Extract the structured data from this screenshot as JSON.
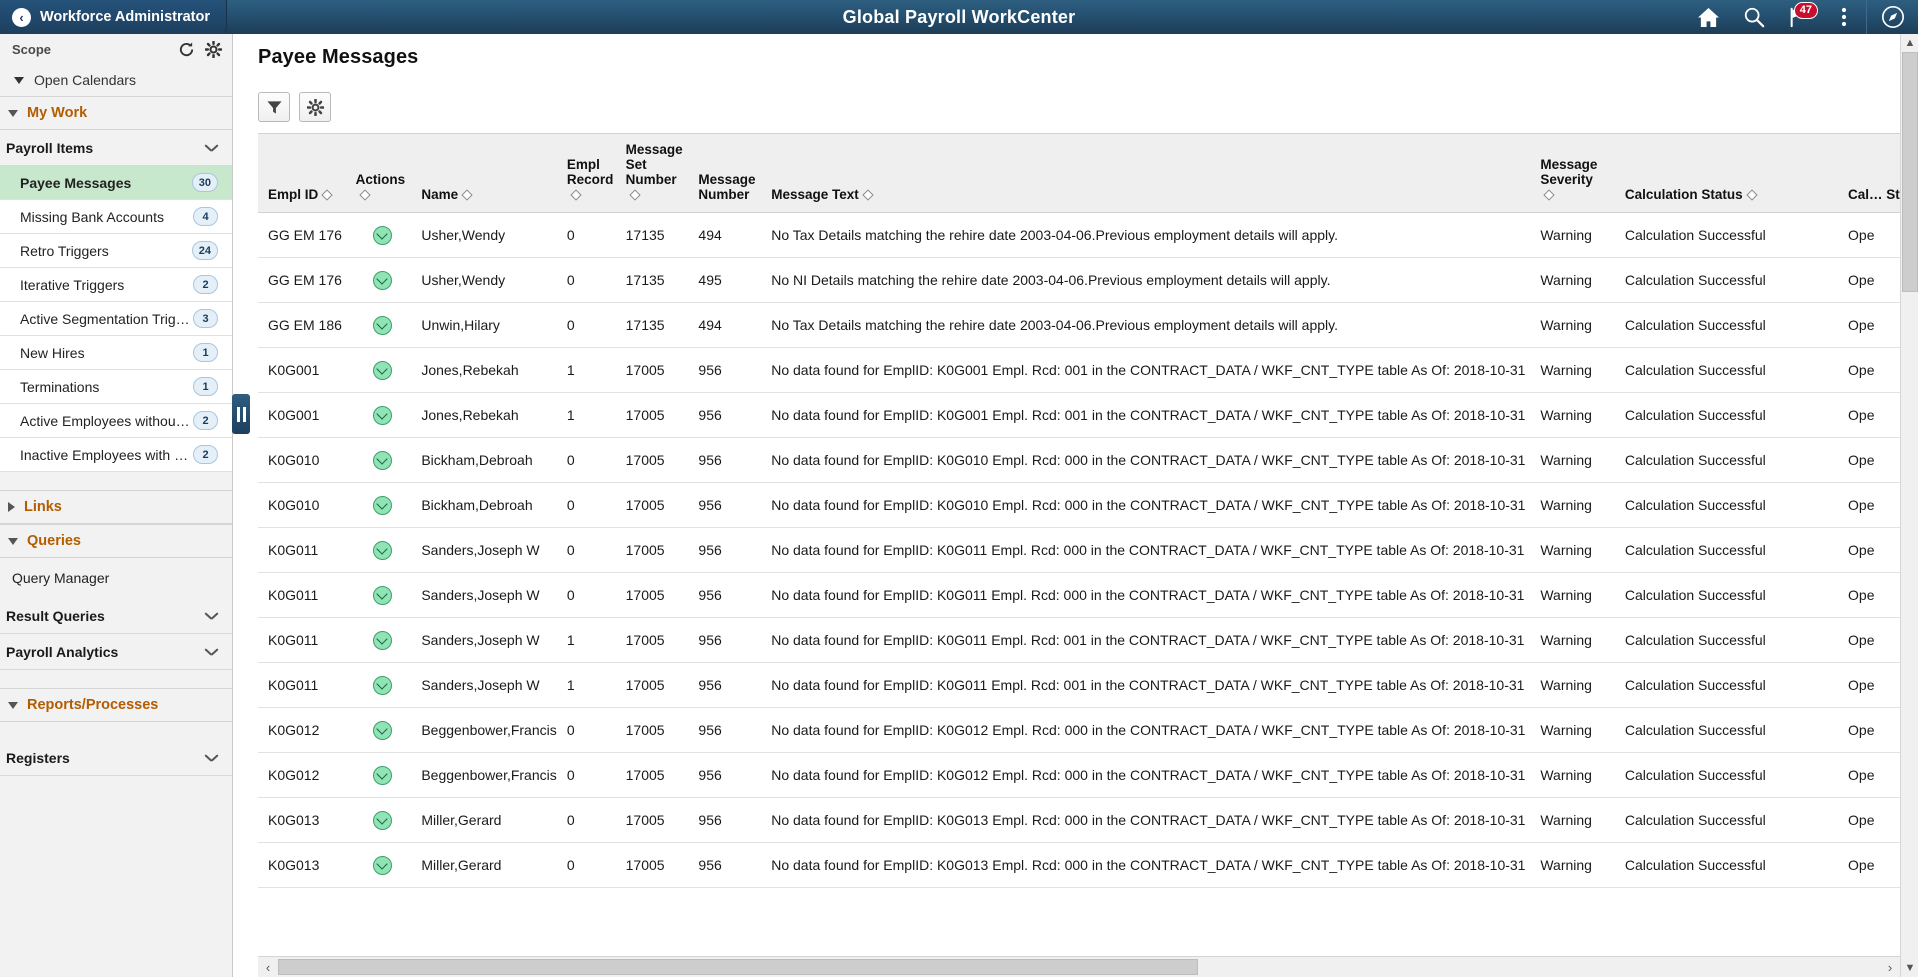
{
  "header": {
    "back_label": "Workforce Administrator",
    "title": "Global Payroll WorkCenter",
    "icons": {
      "home": "home-icon",
      "search": "search-icon",
      "notifications": "notification-flag-icon",
      "notification_count": "47",
      "actions": "kebab-menu-icon",
      "navbar": "navbar-compass-icon"
    }
  },
  "sidebar": {
    "scope_label": "Scope",
    "refresh_icon": "refresh-icon",
    "settings_icon": "gear-icon",
    "open_calendars": "Open Calendars",
    "sections": {
      "my_work": "My Work",
      "links": "Links",
      "queries": "Queries",
      "reports_processes": "Reports/Processes"
    },
    "groups": {
      "payroll_items": "Payroll Items",
      "result_queries": "Result Queries",
      "payroll_analytics": "Payroll Analytics",
      "registers": "Registers"
    },
    "query_manager": "Query Manager",
    "items": [
      {
        "label": "Payee Messages",
        "count": "30",
        "selected": true
      },
      {
        "label": "Missing Bank Accounts",
        "count": "4",
        "selected": false
      },
      {
        "label": "Retro Triggers",
        "count": "24",
        "selected": false
      },
      {
        "label": "Iterative Triggers",
        "count": "2",
        "selected": false
      },
      {
        "label": "Active Segmentation Triggers",
        "count": "3",
        "selected": false
      },
      {
        "label": "New Hires",
        "count": "1",
        "selected": false
      },
      {
        "label": "Terminations",
        "count": "1",
        "selected": false
      },
      {
        "label": "Active Employees without G…",
        "count": "2",
        "selected": false
      },
      {
        "label": "Inactive Employees with Gr…",
        "count": "2",
        "selected": false
      }
    ]
  },
  "main": {
    "page_title": "Payee Messages",
    "toolbar": {
      "filter_icon": "filter-funnel-icon",
      "settings_icon": "gear-icon"
    },
    "columns": [
      {
        "label": "Empl ID",
        "sortable": true
      },
      {
        "label": "Actions",
        "sortable": true
      },
      {
        "label": "Name",
        "sortable": true
      },
      {
        "label": "Empl Record",
        "sortable": true
      },
      {
        "label": "Message Set Number",
        "sortable": true
      },
      {
        "label": "Message Number",
        "sortable": false
      },
      {
        "label": "Message Text",
        "sortable": true
      },
      {
        "label": "Message Severity",
        "sortable": true
      },
      {
        "label": "Calculation Status",
        "sortable": true
      },
      {
        "label": "Cal… Stat…",
        "sortable": false
      }
    ],
    "rows": [
      {
        "empl_id": "GG EM 176",
        "action": "row-action-icon",
        "name": "Usher,Wendy",
        "empl_record": "0",
        "message_set": "17135",
        "message_number": "494",
        "message_text": "No Tax Details matching the rehire date 2003-04-06.Previous employment details will apply.",
        "severity": "Warning",
        "calc_status": "Calculation Successful",
        "cal_status": "Ope"
      },
      {
        "empl_id": "GG EM 176",
        "action": "row-action-icon",
        "name": "Usher,Wendy",
        "empl_record": "0",
        "message_set": "17135",
        "message_number": "495",
        "message_text": "No NI Details matching the rehire date 2003-04-06.Previous employment details will apply.",
        "severity": "Warning",
        "calc_status": "Calculation Successful",
        "cal_status": "Ope"
      },
      {
        "empl_id": "GG EM 186",
        "action": "row-action-icon",
        "name": "Unwin,Hilary",
        "empl_record": "0",
        "message_set": "17135",
        "message_number": "494",
        "message_text": "No Tax Details matching the rehire date 2003-04-06.Previous employment details will apply.",
        "severity": "Warning",
        "calc_status": "Calculation Successful",
        "cal_status": "Ope"
      },
      {
        "empl_id": "K0G001",
        "action": "row-action-icon",
        "name": "Jones,Rebekah",
        "empl_record": "1",
        "message_set": "17005",
        "message_number": "956",
        "message_text": "No data found for EmplID: K0G001 Empl. Rcd: 001 in the CONTRACT_DATA / WKF_CNT_TYPE table As Of: 2018-10-31",
        "severity": "Warning",
        "calc_status": "Calculation Successful",
        "cal_status": "Ope"
      },
      {
        "empl_id": "K0G001",
        "action": "row-action-icon",
        "name": "Jones,Rebekah",
        "empl_record": "1",
        "message_set": "17005",
        "message_number": "956",
        "message_text": "No data found for EmplID: K0G001 Empl. Rcd: 001 in the CONTRACT_DATA / WKF_CNT_TYPE table As Of: 2018-10-31",
        "severity": "Warning",
        "calc_status": "Calculation Successful",
        "cal_status": "Ope"
      },
      {
        "empl_id": "K0G010",
        "action": "row-action-icon",
        "name": "Bickham,Debroah",
        "empl_record": "0",
        "message_set": "17005",
        "message_number": "956",
        "message_text": "No data found for EmplID: K0G010 Empl. Rcd: 000 in the CONTRACT_DATA / WKF_CNT_TYPE table As Of: 2018-10-31",
        "severity": "Warning",
        "calc_status": "Calculation Successful",
        "cal_status": "Ope"
      },
      {
        "empl_id": "K0G010",
        "action": "row-action-icon",
        "name": "Bickham,Debroah",
        "empl_record": "0",
        "message_set": "17005",
        "message_number": "956",
        "message_text": "No data found for EmplID: K0G010 Empl. Rcd: 000 in the CONTRACT_DATA / WKF_CNT_TYPE table As Of: 2018-10-31",
        "severity": "Warning",
        "calc_status": "Calculation Successful",
        "cal_status": "Ope"
      },
      {
        "empl_id": "K0G011",
        "action": "row-action-icon",
        "name": "Sanders,Joseph W",
        "empl_record": "0",
        "message_set": "17005",
        "message_number": "956",
        "message_text": "No data found for EmplID: K0G011 Empl. Rcd: 000 in the CONTRACT_DATA / WKF_CNT_TYPE table As Of: 2018-10-31",
        "severity": "Warning",
        "calc_status": "Calculation Successful",
        "cal_status": "Ope"
      },
      {
        "empl_id": "K0G011",
        "action": "row-action-icon",
        "name": "Sanders,Joseph W",
        "empl_record": "0",
        "message_set": "17005",
        "message_number": "956",
        "message_text": "No data found for EmplID: K0G011 Empl. Rcd: 000 in the CONTRACT_DATA / WKF_CNT_TYPE table As Of: 2018-10-31",
        "severity": "Warning",
        "calc_status": "Calculation Successful",
        "cal_status": "Ope"
      },
      {
        "empl_id": "K0G011",
        "action": "row-action-icon",
        "name": "Sanders,Joseph W",
        "empl_record": "1",
        "message_set": "17005",
        "message_number": "956",
        "message_text": "No data found for EmplID: K0G011 Empl. Rcd: 001 in the CONTRACT_DATA / WKF_CNT_TYPE table As Of: 2018-10-31",
        "severity": "Warning",
        "calc_status": "Calculation Successful",
        "cal_status": "Ope"
      },
      {
        "empl_id": "K0G011",
        "action": "row-action-icon",
        "name": "Sanders,Joseph W",
        "empl_record": "1",
        "message_set": "17005",
        "message_number": "956",
        "message_text": "No data found for EmplID: K0G011 Empl. Rcd: 001 in the CONTRACT_DATA / WKF_CNT_TYPE table As Of: 2018-10-31",
        "severity": "Warning",
        "calc_status": "Calculation Successful",
        "cal_status": "Ope"
      },
      {
        "empl_id": "K0G012",
        "action": "row-action-icon",
        "name": "Beggenbower,Francis",
        "empl_record": "0",
        "message_set": "17005",
        "message_number": "956",
        "message_text": "No data found for EmplID: K0G012 Empl. Rcd: 000 in the CONTRACT_DATA / WKF_CNT_TYPE table As Of: 2018-10-31",
        "severity": "Warning",
        "calc_status": "Calculation Successful",
        "cal_status": "Ope"
      },
      {
        "empl_id": "K0G012",
        "action": "row-action-icon",
        "name": "Beggenbower,Francis",
        "empl_record": "0",
        "message_set": "17005",
        "message_number": "956",
        "message_text": "No data found for EmplID: K0G012 Empl. Rcd: 000 in the CONTRACT_DATA / WKF_CNT_TYPE table As Of: 2018-10-31",
        "severity": "Warning",
        "calc_status": "Calculation Successful",
        "cal_status": "Ope"
      },
      {
        "empl_id": "K0G013",
        "action": "row-action-icon",
        "name": "Miller,Gerard",
        "empl_record": "0",
        "message_set": "17005",
        "message_number": "956",
        "message_text": "No data found for EmplID: K0G013 Empl. Rcd: 000 in the CONTRACT_DATA / WKF_CNT_TYPE table As Of: 2018-10-31",
        "severity": "Warning",
        "calc_status": "Calculation Successful",
        "cal_status": "Ope"
      },
      {
        "empl_id": "K0G013",
        "action": "row-action-icon",
        "name": "Miller,Gerard",
        "empl_record": "0",
        "message_set": "17005",
        "message_number": "956",
        "message_text": "No data found for EmplID: K0G013 Empl. Rcd: 000 in the CONTRACT_DATA / WKF_CNT_TYPE table As Of: 2018-10-31",
        "severity": "Warning",
        "calc_status": "Calculation Successful",
        "cal_status": "Ope"
      }
    ]
  },
  "colors": {
    "header_bar": "#255070",
    "selected_row": "#c7e8cd",
    "section_text": "#b35c00",
    "badge_red": "#c8102e",
    "action_green": "#8fe3b5"
  }
}
